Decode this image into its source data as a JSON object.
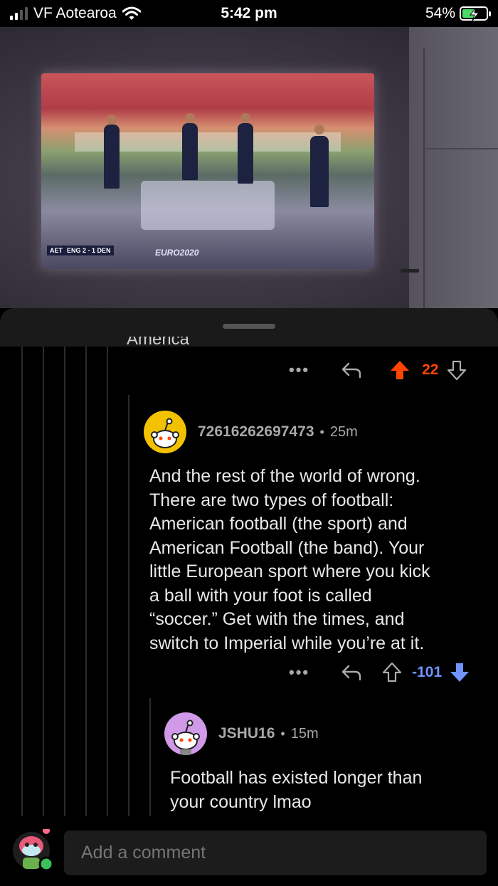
{
  "status_bar": {
    "carrier": "VF Aotearoa",
    "time": "5:42 pm",
    "battery_percent": "54%",
    "battery_level": 0.54,
    "icons": [
      "signal-icon",
      "wifi-icon",
      "battery-charging-icon"
    ]
  },
  "media": {
    "scoreboard": [
      "AET",
      "ENG 2 - 1 DEN"
    ],
    "logo_text": "EURO2020"
  },
  "parent_comment": {
    "clipped_text": "America",
    "actions": {
      "more": "•••",
      "score": "22",
      "vote_state": "upvoted",
      "accent_color": "#ff4500"
    }
  },
  "comment_1": {
    "username": "72616262697473",
    "separator": "•",
    "time": "25m",
    "body_lines": [
      "And the rest of the world of wrong.",
      "There are two types of football:",
      "American football (the sport) and",
      "American Football (the band). Your",
      "little European sport where you kick",
      "a ball with your foot is called",
      "“soccer.” Get with the times, and",
      "switch to Imperial while you’re at it."
    ],
    "actions": {
      "more": "•••",
      "score": "-101",
      "vote_state": "downvoted",
      "accent_color": "#7193ff"
    },
    "avatar_color": "#f2c200"
  },
  "comment_2": {
    "username": "JSHU16",
    "separator": "•",
    "time": "15m",
    "body_lines": [
      "Football has existed longer than",
      "your country lmao"
    ],
    "avatar_color": "#d09ae8"
  },
  "composer": {
    "placeholder": "Add a comment"
  }
}
